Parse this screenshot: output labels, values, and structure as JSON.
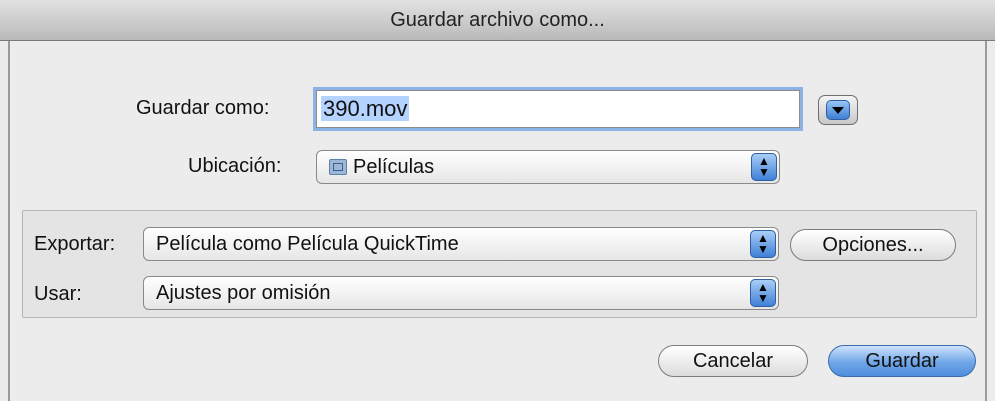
{
  "window": {
    "title": "Guardar archivo como..."
  },
  "save_as": {
    "label": "Guardar como:",
    "value": "390.mov"
  },
  "location": {
    "label": "Ubicación:",
    "value": "Películas",
    "icon": "folder-icon"
  },
  "export": {
    "label": "Exportar:",
    "value": "Película como Película QuickTime",
    "options_label": "Opciones..."
  },
  "use": {
    "label": "Usar:",
    "value": "Ajustes por omisión"
  },
  "buttons": {
    "cancel": "Cancelar",
    "save": "Guardar"
  },
  "popup_arrows": "▲\n▼",
  "colors": {
    "accent": "#3f80d7",
    "focus_ring": "#8cb3e6"
  }
}
